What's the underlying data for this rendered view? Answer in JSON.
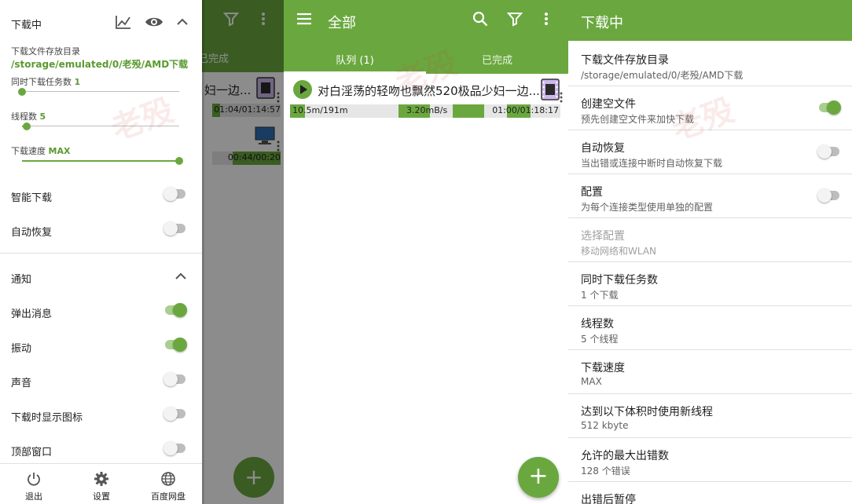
{
  "colors": {
    "accent": "#6aa83f",
    "accent_text": "#5a9a30"
  },
  "panel1": {
    "background": {
      "tab_done": "已完成",
      "rows": [
        {
          "title": "妇一边...",
          "time": "01:04/01:14:57",
          "progress": 0.12
        },
        {
          "title": "",
          "time": "00:44/00:20",
          "progress": 0.0
        }
      ]
    },
    "drawer": {
      "title": "下载中",
      "icons": [
        "chart-icon",
        "eye-icon",
        "chevron-up-icon"
      ],
      "dir_label": "下载文件存放目录",
      "dir_path": "/storage/emulated/0/老殁/AMD下载",
      "concurrent": {
        "label": "同时下载任务数",
        "value": "1",
        "level": 0.0
      },
      "threads": {
        "label": "线程数",
        "value": "5",
        "level": 0.03
      },
      "speed": {
        "label": "下载速度",
        "value": "MAX",
        "level": 1.0
      },
      "toggles_top": [
        {
          "label": "智能下载",
          "on": false
        },
        {
          "label": "自动恢复",
          "on": false
        }
      ],
      "notify_title": "通知",
      "toggles_notify": [
        {
          "label": "弹出消息",
          "on": true
        },
        {
          "label": "振动",
          "on": true
        },
        {
          "label": "声音",
          "on": false
        },
        {
          "label": "下载时显示图标",
          "on": false
        },
        {
          "label": "顶部窗口",
          "on": false
        }
      ],
      "bottom": [
        {
          "label": "退出",
          "icon": "power-icon"
        },
        {
          "label": "设置",
          "icon": "gear-icon"
        },
        {
          "label": "百度网盘",
          "icon": "globe-icon"
        }
      ]
    }
  },
  "panel2": {
    "title": "全部",
    "tabs": [
      "队列 (1)",
      "已完成"
    ],
    "download": {
      "title": "对白淫荡的轻吻也飘然520极品少妇一边...",
      "size": "10.5m/191m",
      "speed": "3.20mB/s",
      "time": "01:00/01:18:17",
      "progress": 0.055
    },
    "fab": "+"
  },
  "panel3": {
    "title": "下载中",
    "items": [
      {
        "title": "下载文件存放目录",
        "sub": "/storage/emulated/0/老殁/AMD下载"
      },
      {
        "title": "创建空文件",
        "sub": "预先创建空文件来加快下载",
        "switch": true,
        "on": true
      },
      {
        "title": "自动恢复",
        "sub": "当出错或连接中断时自动恢复下载",
        "switch": true,
        "on": false
      },
      {
        "title": "配置",
        "sub": "为每个连接类型使用单独的配置",
        "switch": true,
        "on": false
      },
      {
        "title": "选择配置",
        "sub": "移动网络和WLAN",
        "disabled": true
      },
      {
        "title": "同时下载任务数",
        "sub": "1 个下载"
      },
      {
        "title": "线程数",
        "sub": "5 个线程"
      },
      {
        "title": "下载速度",
        "sub": "MAX"
      },
      {
        "title": "达到以下体积时使用新线程",
        "sub": "512 kbyte"
      },
      {
        "title": "允许的最大出错数",
        "sub": "128 个错误"
      },
      {
        "title": "出错后暂停",
        "sub": ""
      }
    ]
  },
  "watermark": "老殁"
}
